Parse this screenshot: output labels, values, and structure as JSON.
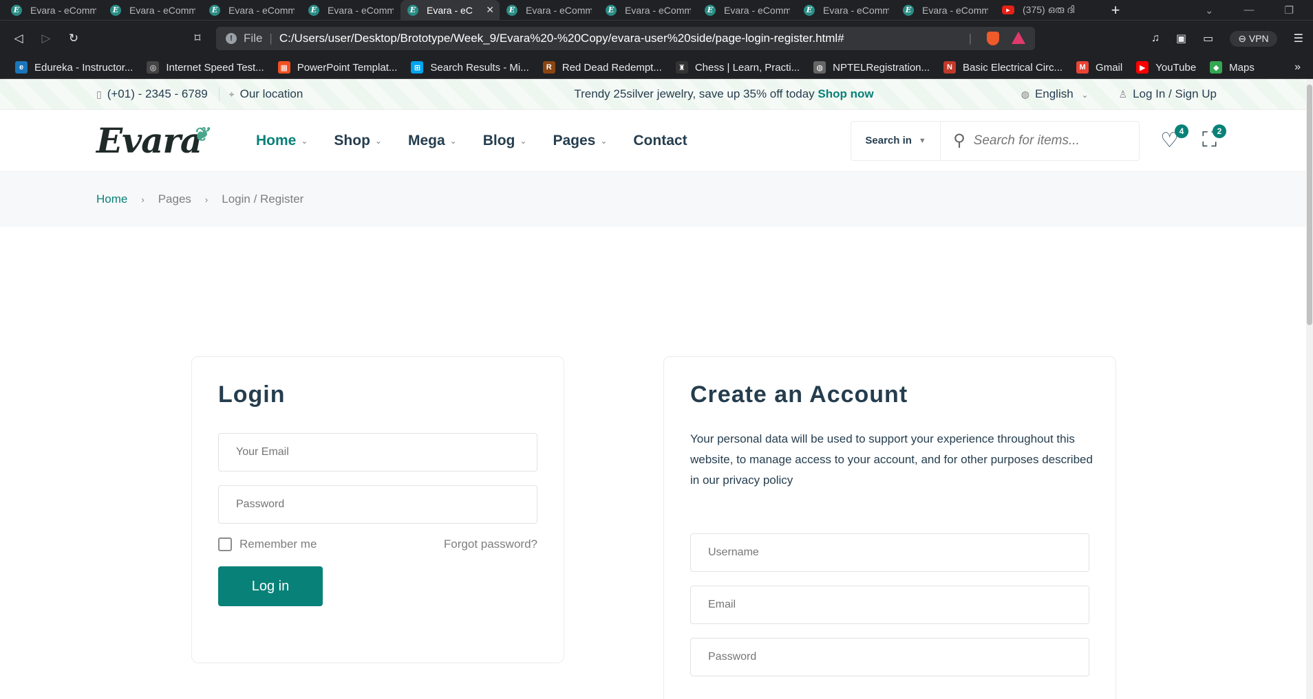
{
  "browser": {
    "tabs": [
      {
        "label": "Evara - eComm",
        "active": false
      },
      {
        "label": "Evara - eComm",
        "active": false
      },
      {
        "label": "Evara - eComm",
        "active": false
      },
      {
        "label": "Evara - eComm",
        "active": false
      },
      {
        "label": "Evara - eC",
        "active": true
      },
      {
        "label": "Evara - eComm",
        "active": false
      },
      {
        "label": "Evara - eComm",
        "active": false
      },
      {
        "label": "Evara - eComm",
        "active": false
      },
      {
        "label": "Evara - eComm",
        "active": false
      },
      {
        "label": "Evara - eComm",
        "active": false
      },
      {
        "label": "(375) ഒരു ദി",
        "active": false
      }
    ],
    "new_tab": "+",
    "url_scheme": "File",
    "url": "C:/Users/user/Desktop/Brototype/Week_9/Evara%20-%20Copy/evara-user%20side/page-login-register.html#",
    "vpn_label": "VPN",
    "bookmarks": [
      {
        "label": "Edureka - Instructor...",
        "icon": "e",
        "color": "#1b75bb"
      },
      {
        "label": "Internet Speed Test...",
        "icon": "◎",
        "color": "#444444"
      },
      {
        "label": "PowerPoint Templat...",
        "icon": "▦",
        "color": "#f25022"
      },
      {
        "label": "Search Results - Mi...",
        "icon": "⊞",
        "color": "#00a4ef"
      },
      {
        "label": "Red Dead Redempt...",
        "icon": "R",
        "color": "#8b4513"
      },
      {
        "label": "Chess | Learn, Practi...",
        "icon": "♜",
        "color": "#333333"
      },
      {
        "label": "NPTELRegistration...",
        "icon": "◍",
        "color": "#666666"
      },
      {
        "label": "Basic Electrical Circ...",
        "icon": "N",
        "color": "#c0392b"
      },
      {
        "label": "Gmail",
        "icon": "M",
        "color": "#ea4335"
      },
      {
        "label": "YouTube",
        "icon": "▶",
        "color": "#ff0000"
      },
      {
        "label": "Maps",
        "icon": "◆",
        "color": "#34a853"
      }
    ]
  },
  "site": {
    "top": {
      "phone": "(+01) - 2345 - 6789",
      "location": "Our location",
      "promo": "Trendy 25silver jewelry, save up 35% off today",
      "promo_link": "Shop now",
      "language": "English",
      "auth": "Log In / Sign Up"
    },
    "logo": "Evara",
    "menu": [
      {
        "label": "Home",
        "active": true,
        "dropdown": true
      },
      {
        "label": "Shop",
        "active": false,
        "dropdown": true
      },
      {
        "label": "Mega",
        "active": false,
        "dropdown": true
      },
      {
        "label": "Blog",
        "active": false,
        "dropdown": true
      },
      {
        "label": "Pages",
        "active": false,
        "dropdown": true
      },
      {
        "label": "Contact",
        "active": false,
        "dropdown": false
      }
    ],
    "search": {
      "category_label": "Search in",
      "placeholder": "Search for items..."
    },
    "wishlist_count": "4",
    "cart_count": "2",
    "breadcrumb": [
      "Home",
      "Pages",
      "Login / Register"
    ],
    "login": {
      "title": "Login",
      "email_placeholder": "Your Email",
      "password_placeholder": "Password",
      "remember": "Remember me",
      "forgot": "Forgot password?",
      "submit": "Log in"
    },
    "register": {
      "title": "Create an Account",
      "privacy_text": "Your personal data will be used to support your experience throughout this website, to manage access to your account, and for other purposes described in our privacy policy",
      "username_placeholder": "Username",
      "email_placeholder": "Email",
      "password_placeholder": "Password"
    },
    "colors": {
      "accent": "#088178",
      "text": "#253D4E",
      "muted": "#7e7e7e"
    }
  }
}
